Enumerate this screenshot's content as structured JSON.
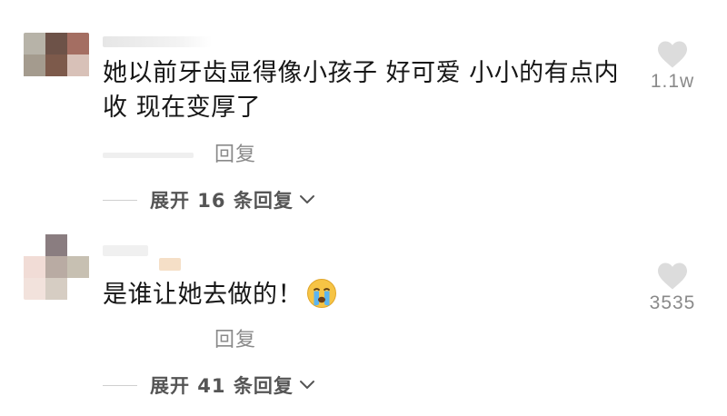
{
  "colors": {
    "text": "#161616",
    "secondary": "#8a8a8a",
    "like_icon": "#dcdcdc"
  },
  "comments": [
    {
      "text_line1": "她以前牙齿显得像小孩子 好可爱 小小的有点内",
      "text_line2": "收  现在变厚了",
      "reply_label": "回复",
      "like_icon": "heart-icon",
      "like_count": "1.1w",
      "expand_label": "展开 16 条回复"
    },
    {
      "text_line1": "是谁让她去做的！",
      "emoji": "crying-face-emoji",
      "reply_label": "回复",
      "like_icon": "heart-icon",
      "like_count": "3535",
      "expand_label": "展开 41 条回复"
    }
  ]
}
